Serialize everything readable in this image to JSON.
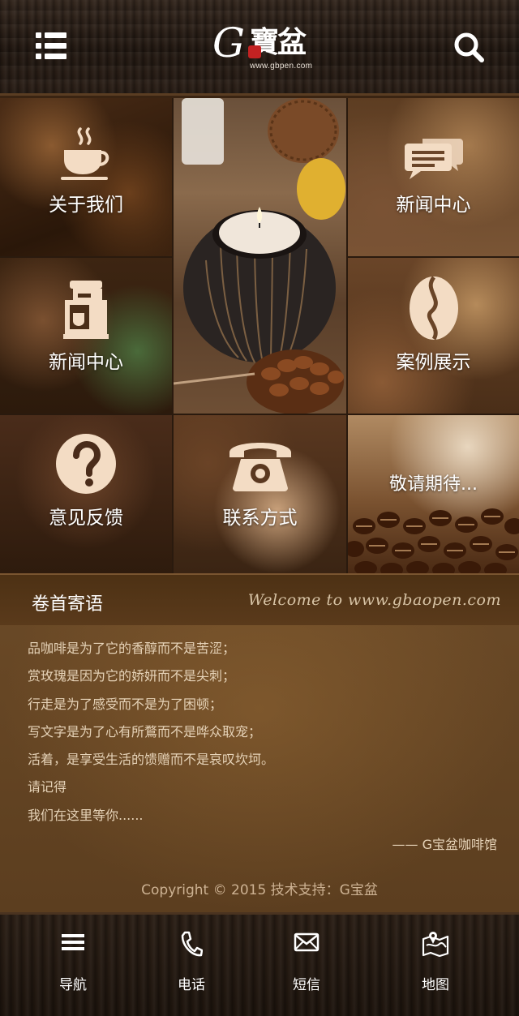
{
  "header": {
    "logo_mark": "G",
    "logo_chars": "寶盆",
    "logo_url": "www.gbpen.com",
    "menu_icon": "list-menu-icon",
    "search_icon": "search-icon"
  },
  "tiles": [
    {
      "label": "关于我们",
      "icon": "coffee-cup-icon"
    },
    {
      "label": "",
      "icon": "candle-image"
    },
    {
      "label": "新闻中心",
      "icon": "message-icon"
    },
    {
      "label": "新闻中心",
      "icon": "coffee-machine-icon"
    },
    {
      "label": "案例展示",
      "icon": "coffee-bean-icon"
    },
    {
      "label": "意见反馈",
      "icon": "question-icon"
    },
    {
      "label": "联系方式",
      "icon": "telephone-icon"
    },
    {
      "label": "敬请期待...",
      "icon": "coffee-beans-image"
    }
  ],
  "intro": {
    "title": "卷首寄语",
    "welcome": "Welcome to www.gbaopen.com",
    "lines": [
      "品咖啡是为了它的香醇而不是苦涩；",
      "赏玫瑰是因为它的娇妍而不是尖刺；",
      "行走是为了感受而不是为了困顿；",
      "写文字是为了心有所鶩而不是哗众取宠；",
      "活着，是享受生活的馈赠而不是哀叹坎坷。",
      "请记得",
      "我们在这里等你......"
    ],
    "signature": "——  G宝盆咖啡馆",
    "copyright": "Copyright  © 2015 技术支持：G宝盆"
  },
  "footer": {
    "items": [
      {
        "label": "导航",
        "icon": "menu-icon"
      },
      {
        "label": "电话",
        "icon": "phone-icon"
      },
      {
        "label": "短信",
        "icon": "envelope-icon"
      },
      {
        "label": "地图",
        "icon": "map-icon"
      }
    ]
  },
  "colors": {
    "accent": "#f3dcc4",
    "text_light": "#e6d3b8",
    "wood_dark": "#221811"
  }
}
